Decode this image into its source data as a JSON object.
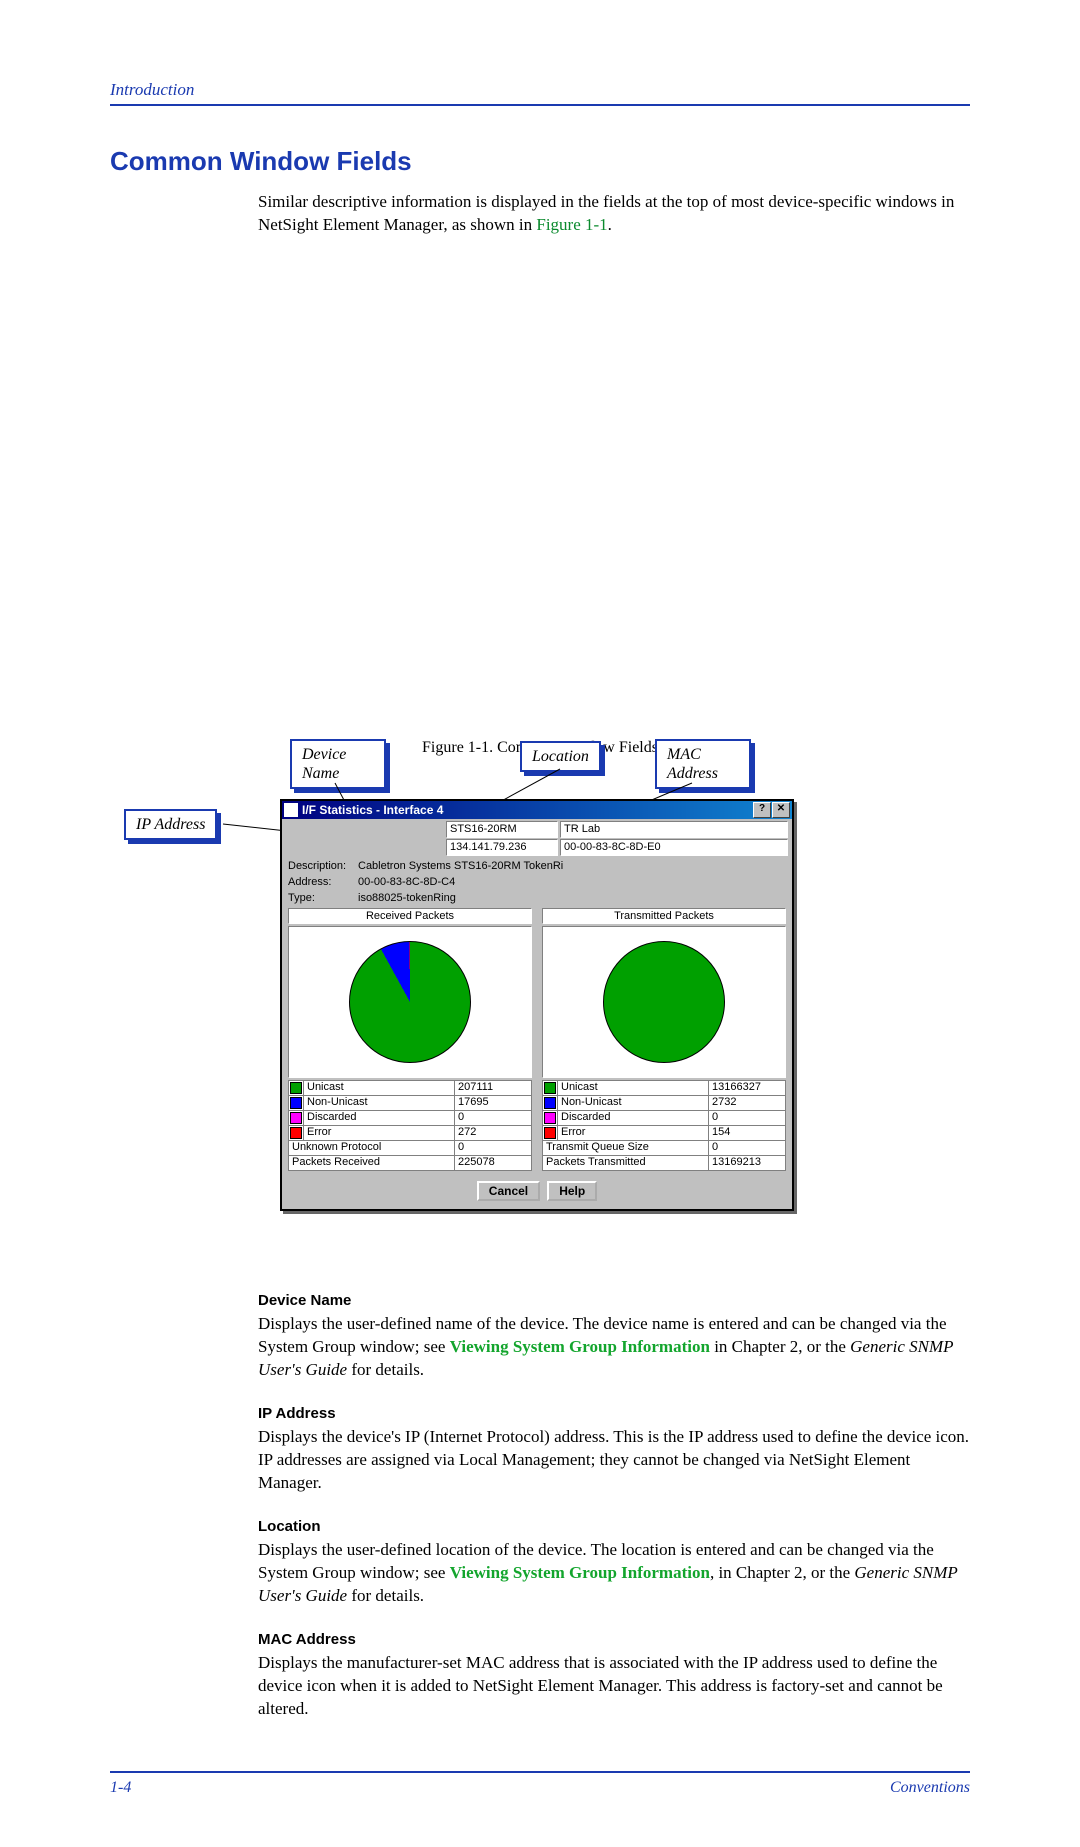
{
  "header": "Introduction",
  "section_title": "Common Window Fields",
  "intro_1": "Similar descriptive information is displayed in the fields at the top of most device-specific windows in NetSight Element Manager, as shown in ",
  "intro_figref": "Figure 1-1",
  "intro_2": ".",
  "callouts": {
    "device_name": "Device Name",
    "ip_address": "IP Address",
    "location": "Location",
    "mac_address": "MAC Address"
  },
  "window": {
    "title": "I/F Statistics - Interface 4",
    "help_btn": "?",
    "close_btn": "✕",
    "cells": {
      "device": "STS16-20RM",
      "location": "TR Lab",
      "ip": "134.141.79.236",
      "mac": "00-00-83-8C-8D-E0"
    },
    "description_label": "Description:",
    "description": "Cabletron Systems STS16-20RM TokenRi",
    "address_label": "Address:",
    "address": "00-00-83-8C-8D-C4",
    "type_label": "Type:",
    "type": "iso88025-tokenRing",
    "buttons": {
      "cancel": "Cancel",
      "help": "Help"
    }
  },
  "chart_data": [
    {
      "type": "pie",
      "title": "Received Packets",
      "series": [
        {
          "name": "Unicast",
          "value": 207111,
          "color": "#00a000"
        },
        {
          "name": "Non-Unicast",
          "value": 17695,
          "color": "#0000ff"
        },
        {
          "name": "Discarded",
          "value": 0,
          "color": "#ff00ff"
        },
        {
          "name": "Error",
          "value": 272,
          "color": "#ff0000"
        }
      ],
      "extras": [
        {
          "label": "Unknown Protocol",
          "value": 0
        },
        {
          "label": "Packets Received",
          "value": 225078
        }
      ]
    },
    {
      "type": "pie",
      "title": "Transmitted Packets",
      "series": [
        {
          "name": "Unicast",
          "value": 13166327,
          "color": "#00a000"
        },
        {
          "name": "Non-Unicast",
          "value": 2732,
          "color": "#0000ff"
        },
        {
          "name": "Discarded",
          "value": 0,
          "color": "#ff00ff"
        },
        {
          "name": "Error",
          "value": 154,
          "color": "#ff0000"
        }
      ],
      "extras": [
        {
          "label": "Transmit Queue Size",
          "value": 0
        },
        {
          "label": "Packets Transmitted",
          "value": 13169213
        }
      ]
    }
  ],
  "figure_caption": "Figure 1-1. Common Window Fields",
  "defs": {
    "device_name": {
      "h": "Device Name",
      "t1": "Displays the user-defined name of the device. The device name is entered and can be changed via the System Group window; see ",
      "link": "Viewing System Group Information",
      "t2": " in Chapter 2, or the ",
      "em": "Generic SNMP User's Guide",
      "t3": " for details."
    },
    "ip": {
      "h": "IP Address",
      "t": "Displays the device's IP (Internet Protocol) address. This is the IP address used to define the device icon. IP addresses are assigned via Local Management; they cannot be changed via NetSight Element Manager."
    },
    "location": {
      "h": "Location",
      "t1": "Displays the user-defined location of the device. The location is entered and can be changed via the System Group window; see ",
      "link": "Viewing System Group Information",
      "t2": ", in Chapter 2, or the ",
      "em": "Generic SNMP User's Guide",
      "t3": " for details."
    },
    "mac": {
      "h": "MAC Address",
      "t": "Displays the manufacturer-set MAC address that is associated with the IP address used to define the device icon when it is added to NetSight Element Manager. This address is factory-set and cannot be altered."
    }
  },
  "footer": {
    "left": "1-4",
    "right": "Conventions"
  }
}
